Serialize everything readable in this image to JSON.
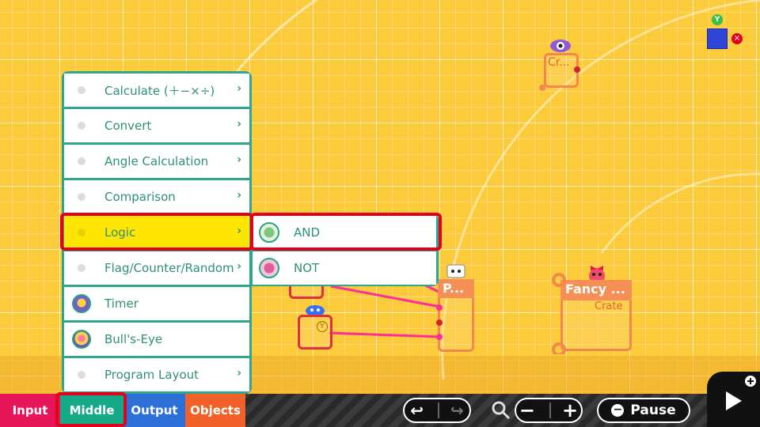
{
  "canvas": {
    "nodons": {
      "crate_small": {
        "label": "Cr..."
      },
      "person": {
        "label": "P..."
      },
      "fancy": {
        "label": "Fancy ...",
        "sub": "Crate"
      },
      "button_badge": "Y",
      "top_badge": "Y"
    }
  },
  "menu": {
    "items": [
      {
        "label": "Calculate (＋−×÷)",
        "submenu": true,
        "icon": "dot"
      },
      {
        "label": "Convert",
        "submenu": true,
        "icon": "dot"
      },
      {
        "label": "Angle Calculation",
        "submenu": true,
        "icon": "dot"
      },
      {
        "label": "Comparison",
        "submenu": true,
        "icon": "dot"
      },
      {
        "label": "Logic",
        "submenu": true,
        "icon": "dot",
        "selected": true
      },
      {
        "label": "Flag/Counter/Random",
        "submenu": true,
        "icon": "dot"
      },
      {
        "label": "Timer",
        "submenu": false,
        "icon": "timer-nodon-icon"
      },
      {
        "label": "Bull's-Eye",
        "submenu": false,
        "icon": "bullseye-nodon-icon"
      },
      {
        "label": "Program Layout",
        "submenu": true,
        "icon": "dot"
      }
    ],
    "chevron": "›"
  },
  "submenu": {
    "items": [
      {
        "label": "AND",
        "icon": "and-nodon-icon"
      },
      {
        "label": "NOT",
        "icon": "not-nodon-icon"
      }
    ]
  },
  "tabs": {
    "input": "Input",
    "middle": "Middle",
    "output": "Output",
    "objects": "Objects"
  },
  "toolbar": {
    "undo_icon": "↩",
    "redo_icon": "↪",
    "zoom_minus": "−",
    "zoom_plus": "+",
    "pause_label": "Pause"
  },
  "colors": {
    "accent_green": "#2ea78d",
    "selected_yellow": "#ffe600",
    "highlight_red": "#e3001b",
    "tab_input": "#e8155b",
    "tab_middle": "#16a987",
    "tab_output": "#2c6fd6",
    "tab_objects": "#f0622a"
  }
}
